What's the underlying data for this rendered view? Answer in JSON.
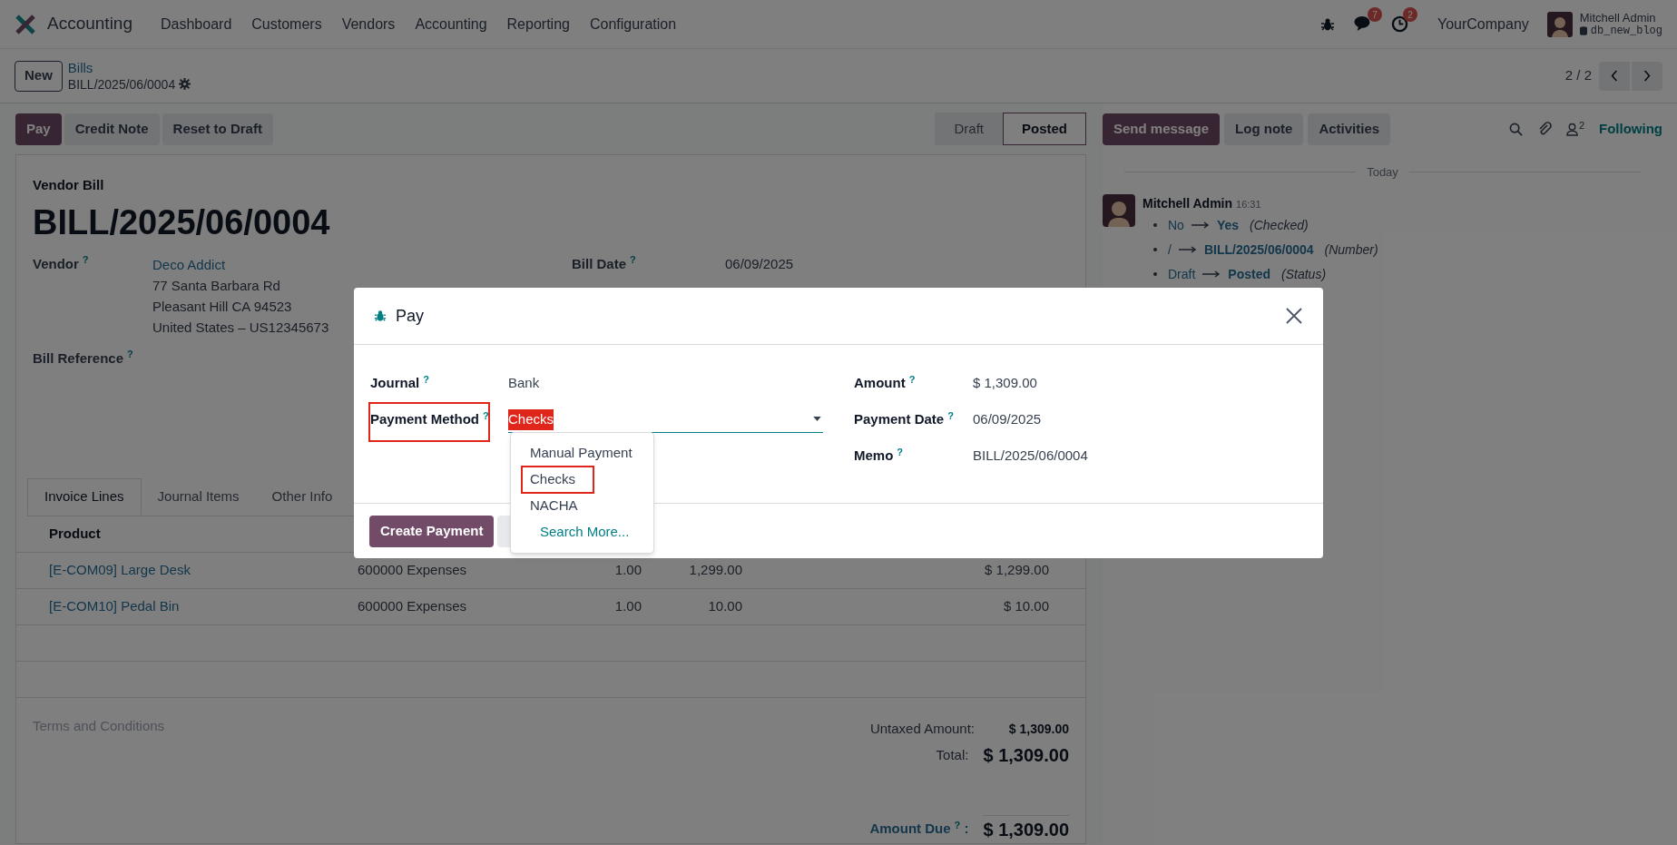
{
  "navbar": {
    "app_name": "Accounting",
    "menu": [
      "Dashboard",
      "Customers",
      "Vendors",
      "Accounting",
      "Reporting",
      "Configuration"
    ],
    "chat_badge": "7",
    "activity_badge": "2",
    "company": "YourCompany",
    "user": "Mitchell Admin",
    "database": "db_new_blog"
  },
  "control_panel": {
    "new_button": "New",
    "breadcrumb": "Bills",
    "record": "BILL/2025/06/0004",
    "pager": "2 / 2"
  },
  "actions": [
    {
      "label": "Pay",
      "kind": "primary"
    },
    {
      "label": "Credit Note",
      "kind": "secondary"
    },
    {
      "label": "Reset to Draft",
      "kind": "secondary"
    }
  ],
  "status_bar": [
    {
      "label": "Draft",
      "selected": false
    },
    {
      "label": "Posted",
      "selected": true
    }
  ],
  "chatter": {
    "buttons": [
      {
        "label": "Send message",
        "kind": "primary"
      },
      {
        "label": "Log note",
        "kind": "secondary"
      },
      {
        "label": "Activities",
        "kind": "secondary"
      }
    ],
    "followers_count": "2",
    "follow_label": "Following",
    "date_separator": "Today",
    "message": {
      "author": "Mitchell Admin",
      "time": "16:31",
      "changes": [
        {
          "old": "No",
          "new": "Yes",
          "field": "(Checked)"
        },
        {
          "old": "/",
          "new": "BILL/2025/06/0004",
          "field": "(Number)"
        },
        {
          "old": "Draft",
          "new": "Posted",
          "field": "(Status)"
        }
      ]
    }
  },
  "form": {
    "type_label": "Vendor Bill",
    "name": "BILL/2025/06/0004",
    "vendor": {
      "label": "Vendor",
      "help": "?",
      "value": "Deco Addict",
      "address": [
        "77 Santa Barbara Rd",
        "Pleasant Hill CA 94523",
        "United States – US12345673"
      ]
    },
    "bill_date": {
      "label": "Bill Date",
      "help": "?",
      "value": "06/09/2025"
    },
    "bill_reference": {
      "label": "Bill Reference",
      "help": "?"
    },
    "tabs": [
      {
        "label": "Invoice Lines",
        "selected": true
      },
      {
        "label": "Journal Items",
        "selected": false
      },
      {
        "label": "Other Info",
        "selected": false
      }
    ],
    "table": {
      "columns": [
        "Product"
      ],
      "rows": [
        {
          "product": "[E-COM09] Large Desk",
          "account": "600000 Expenses",
          "quantity": "1.00",
          "price": "1,299.00",
          "total": "$ 1,299.00"
        },
        {
          "product": "[E-COM10] Pedal Bin",
          "account": "600000 Expenses",
          "quantity": "1.00",
          "price": "10.00",
          "total": "$ 10.00"
        }
      ]
    },
    "terms_placeholder": "Terms and Conditions",
    "untaxed": {
      "label": "Untaxed Amount:",
      "value": "$ 1,309.00"
    },
    "total": {
      "label": "Total:",
      "value": "$ 1,309.00"
    },
    "amount_due": {
      "label": "Amount Due",
      "help": "?",
      "colon": ":",
      "value": "$ 1,309.00"
    }
  },
  "dialog": {
    "title": "Pay",
    "left_fields": [
      {
        "label": "Journal",
        "help": "?",
        "value": "Bank",
        "kind": "text",
        "annotated": false
      },
      {
        "label": "Payment Method",
        "help": "?",
        "value": "Checks",
        "kind": "select",
        "highlighted": true,
        "annotated": true
      }
    ],
    "right_fields": [
      {
        "label": "Amount",
        "help": "?",
        "value": "$ 1,309.00"
      },
      {
        "label": "Payment Date",
        "help": "?",
        "value": "06/09/2025"
      },
      {
        "label": "Memo",
        "help": "?",
        "value": "BILL/2025/06/0004"
      }
    ],
    "dropdown": [
      {
        "label": "Manual Payment",
        "kind": "option",
        "annotated": false
      },
      {
        "label": "Checks",
        "kind": "option",
        "annotated": true
      },
      {
        "label": "NACHA",
        "kind": "option",
        "annotated": false
      },
      {
        "label": "Search More...",
        "kind": "search",
        "annotated": false
      }
    ],
    "primary_button": "Create Payment"
  }
}
